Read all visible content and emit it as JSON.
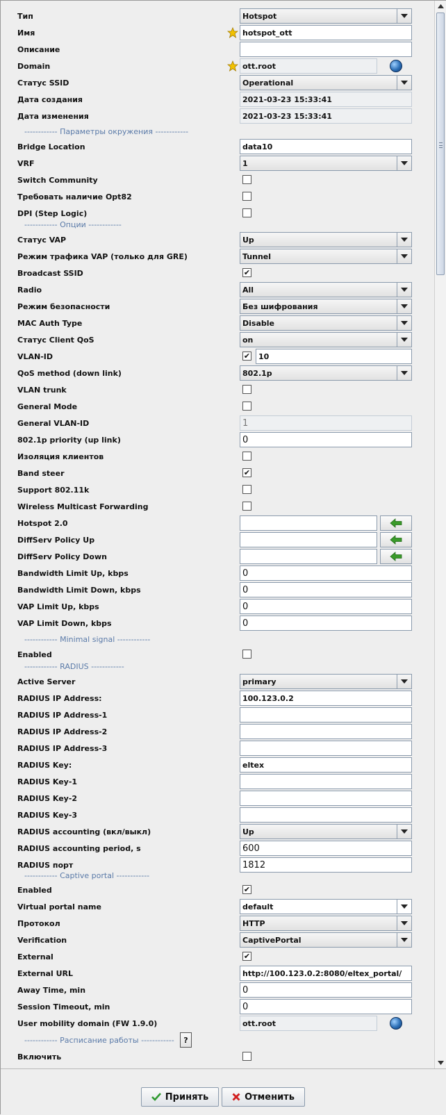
{
  "fields": {
    "type": {
      "label": "Тип",
      "value": "Hotspot"
    },
    "name": {
      "label": "Имя",
      "value": "hotspot_ott"
    },
    "description": {
      "label": "Описание",
      "value": ""
    },
    "domain": {
      "label": "Domain",
      "value": "ott.root"
    },
    "ssid_status": {
      "label": "Статус SSID",
      "value": "Operational"
    },
    "created": {
      "label": "Дата создания",
      "value": "2021-03-23 15:33:41"
    },
    "modified": {
      "label": "Дата изменения",
      "value": "2021-03-23 15:33:41"
    },
    "env_section": "------------ Параметры окружения ------------",
    "bridge_location": {
      "label": "Bridge Location",
      "value": "data10"
    },
    "vrf": {
      "label": "VRF",
      "value": "1"
    },
    "switch_community": {
      "label": "Switch Community",
      "checked": false
    },
    "opt82": {
      "label": "Требовать наличие Opt82",
      "checked": false
    },
    "dpi": {
      "label": "DPI (Step Logic)",
      "checked": false
    },
    "options_section": "------------ Опции ------------",
    "vap_status": {
      "label": "Статус VAP",
      "value": "Up"
    },
    "vap_traffic_mode": {
      "label": "Режим трафика VAP (только для GRE)",
      "value": "Tunnel"
    },
    "broadcast_ssid": {
      "label": "Broadcast SSID",
      "checked": true
    },
    "radio": {
      "label": "Radio",
      "value": "All"
    },
    "security_mode": {
      "label": "Режим безопасности",
      "value": "Без шифрования"
    },
    "mac_auth_type": {
      "label": "MAC Auth Type",
      "value": "Disable"
    },
    "client_qos": {
      "label": "Статус Client QoS",
      "value": "on"
    },
    "vlan_id": {
      "label": "VLAN-ID",
      "checked": true,
      "value": "10"
    },
    "qos_method": {
      "label": "QoS method (down link)",
      "value": "802.1p"
    },
    "vlan_trunk": {
      "label": "VLAN trunk",
      "checked": false
    },
    "general_mode": {
      "label": "General Mode",
      "checked": false
    },
    "general_vlan_id": {
      "label": "General VLAN-ID",
      "value": "1"
    },
    "priority_up": {
      "label": "802.1p priority (up link)",
      "value": "0"
    },
    "client_isolation": {
      "label": "Изоляция клиентов",
      "checked": false
    },
    "band_steer": {
      "label": "Band steer",
      "checked": true
    },
    "support_80211k": {
      "label": "Support 802.11k",
      "checked": false
    },
    "wmf": {
      "label": "Wireless Multicast Forwarding",
      "checked": false
    },
    "hotspot20": {
      "label": "Hotspot 2.0",
      "value": ""
    },
    "diffserv_up": {
      "label": "DiffServ Policy Up",
      "value": ""
    },
    "diffserv_down": {
      "label": "DiffServ Policy Down",
      "value": ""
    },
    "bw_up": {
      "label": "Bandwidth Limit Up, kbps",
      "value": "0"
    },
    "bw_down": {
      "label": "Bandwidth Limit Down, kbps",
      "value": "0"
    },
    "vap_up": {
      "label": "VAP Limit Up, kbps",
      "value": "0"
    },
    "vap_down": {
      "label": "VAP Limit Down, kbps",
      "value": "0"
    },
    "minsig_section": "------------ Minimal signal ------------",
    "minsig_enabled": {
      "label": "Enabled",
      "checked": false
    },
    "radius_section": "------------ RADIUS ------------",
    "active_server": {
      "label": "Active Server",
      "value": "primary"
    },
    "radius_ip": {
      "label": "RADIUS IP Address:",
      "value": "100.123.0.2"
    },
    "radius_ip1": {
      "label": "RADIUS IP Address-1",
      "value": ""
    },
    "radius_ip2": {
      "label": "RADIUS IP Address-2",
      "value": ""
    },
    "radius_ip3": {
      "label": "RADIUS IP Address-3",
      "value": ""
    },
    "radius_key": {
      "label": "RADIUS Key:",
      "value": "eltex"
    },
    "radius_key1": {
      "label": "RADIUS Key-1",
      "value": ""
    },
    "radius_key2": {
      "label": "RADIUS Key-2",
      "value": ""
    },
    "radius_key3": {
      "label": "RADIUS Key-3",
      "value": ""
    },
    "radius_accounting": {
      "label": "RADIUS accounting (вкл/выкл)",
      "value": "Up"
    },
    "radius_acc_period": {
      "label": "RADIUS accounting period, s",
      "value": "600"
    },
    "radius_port": {
      "label": "RADIUS порт",
      "value": "1812"
    },
    "captive_section": "------------ Captive portal ------------",
    "captive_enabled": {
      "label": "Enabled",
      "checked": true
    },
    "virtual_portal": {
      "label": "Virtual portal name",
      "value": "default"
    },
    "protocol": {
      "label": "Протокол",
      "value": "HTTP"
    },
    "verification": {
      "label": "Verification",
      "value": "CaptivePortal"
    },
    "external": {
      "label": "External",
      "checked": true
    },
    "external_url": {
      "label": "External URL",
      "value": "http://100.123.0.2:8080/eltex_portal/"
    },
    "away_time": {
      "label": "Away Time, min",
      "value": "0"
    },
    "session_timeout": {
      "label": "Session Timeout, min",
      "value": "0"
    },
    "mobility_domain": {
      "label": "User mobility domain (FW 1.9.0)",
      "value": "ott.root"
    },
    "schedule_section": "------------ Расписание работы ------------",
    "schedule_help": "?",
    "schedule_enable": {
      "label": "Включить",
      "checked": false
    }
  },
  "footer": {
    "accept": "Принять",
    "cancel": "Отменить"
  },
  "icons": {
    "star": "star-icon",
    "globe": "globe-icon",
    "arrow": "arrow-left-icon",
    "accept": "checkmark-icon",
    "cancel": "x-icon"
  },
  "colors": {
    "section_text": "#5a7aa8",
    "arrow_green": "#3a9a2a",
    "cancel_red": "#d22020",
    "star": "#f2c200"
  }
}
